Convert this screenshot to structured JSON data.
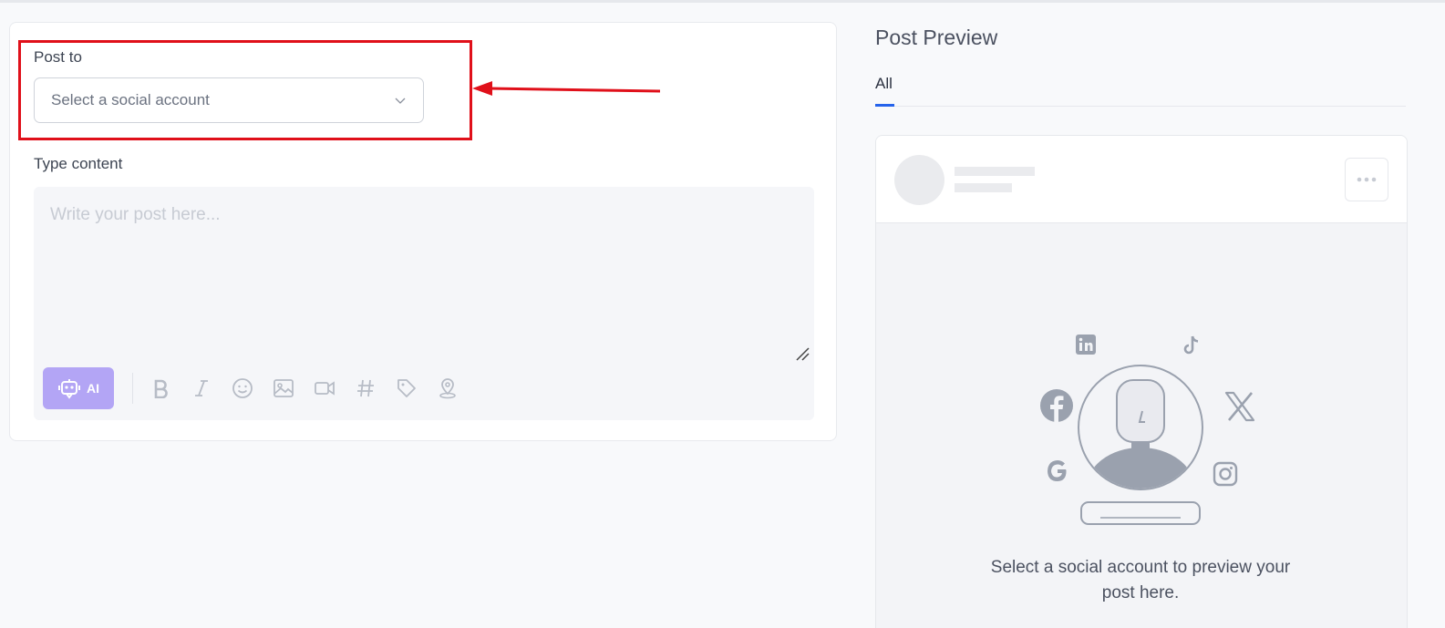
{
  "composer": {
    "post_to_label": "Post to",
    "account_select_placeholder": "Select a social account",
    "type_content_label": "Type content",
    "editor_placeholder": "Write your post here...",
    "ai_button_label": "AI",
    "toolbar_icons": [
      "bold-icon",
      "italic-icon",
      "emoji-icon",
      "image-icon",
      "video-icon",
      "hashtag-icon",
      "tag-icon",
      "location-icon"
    ]
  },
  "preview": {
    "title": "Post Preview",
    "tabs": [
      {
        "label": "All",
        "active": true
      }
    ],
    "empty_message": "Select a social account to preview your post here.",
    "platform_icons": [
      "linkedin-icon",
      "tiktok-icon",
      "facebook-icon",
      "x-icon",
      "google-icon",
      "instagram-icon"
    ]
  },
  "colors": {
    "accent": "#2563eb",
    "ai_button": "#b3a5f5",
    "annotation": "#e0101a",
    "icon_gray": "#9aa1ae"
  }
}
